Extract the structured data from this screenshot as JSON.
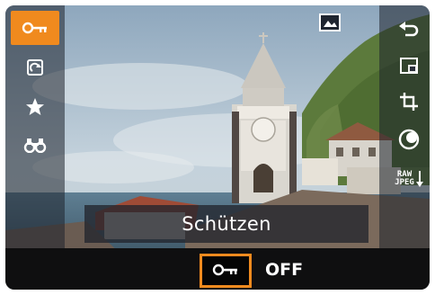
{
  "menu": {
    "function_label": "Schützen",
    "current_value": "OFF"
  },
  "left_icons": [
    "protect-key-icon",
    "rotate-image-icon",
    "rating-star-icon",
    "search-binoculars-icon"
  ],
  "right_icons": [
    "return-arrow-icon",
    "resize-image-icon",
    "crop-icon",
    "creative-filter-icon",
    "raw-jpeg-convert-icon"
  ],
  "right_raw_text": {
    "top": "RAW",
    "bottom": "JPEG"
  },
  "top_icon": "image-frame-icon",
  "colors": {
    "accent": "#f08a1e",
    "overlay": "#1e222c",
    "bar": "#0f0f10"
  }
}
